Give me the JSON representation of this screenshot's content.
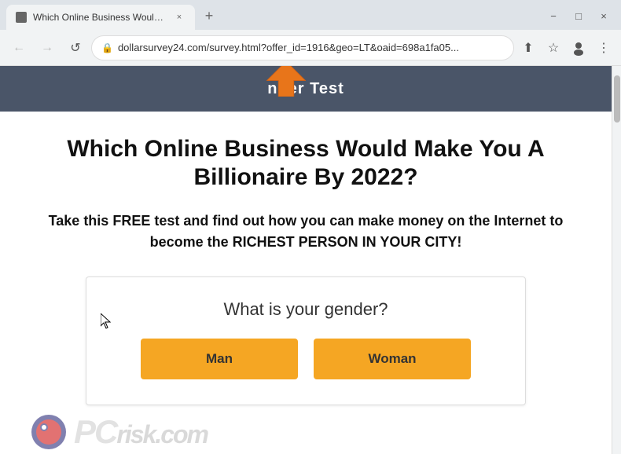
{
  "browser": {
    "tab": {
      "title": "Which Online Business Would M...",
      "favicon_label": "page-favicon"
    },
    "new_tab_label": "+",
    "window_controls": {
      "minimize": "−",
      "maximize": "□",
      "close": "×"
    },
    "nav": {
      "back": "←",
      "forward": "→",
      "refresh": "↺",
      "url": "dollarsurvey24.com/survey.html?offer_id=1916&geo=LT&oaid=698a1fa05...",
      "lock": "🔒"
    }
  },
  "page": {
    "banner_text": "nner Test",
    "headline": "Which Online Business Would Make You A Billionaire By 2022?",
    "subtext": "Take this FREE test and find out how you can make money on the Internet to become the RICHEST PERSON IN YOUR CITY!",
    "survey": {
      "question": "What is your gender?",
      "option_man": "Man",
      "option_woman": "Woman"
    },
    "watermark": "PC risk.com"
  },
  "colors": {
    "header_bg": "#4a5568",
    "button_bg": "#f5a623",
    "page_bg": "#ffffff",
    "outer_bg": "#dee3e8"
  }
}
